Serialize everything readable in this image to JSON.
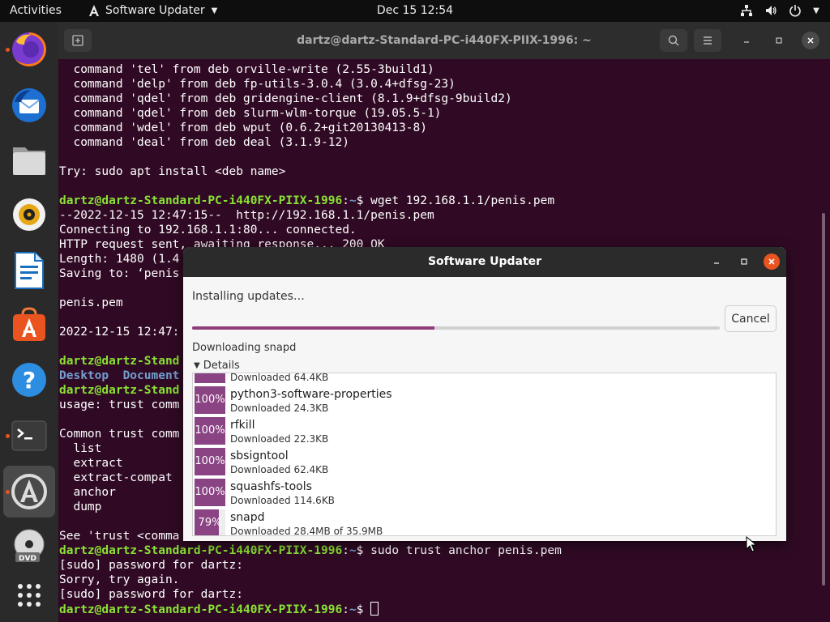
{
  "topbar": {
    "activities": "Activities",
    "app_menu": "Software Updater",
    "clock": "Dec 15  12:54"
  },
  "dock": {
    "items": [
      {
        "name": "firefox-icon",
        "running": true
      },
      {
        "name": "thunderbird-icon",
        "running": false
      },
      {
        "name": "files-icon",
        "running": false
      },
      {
        "name": "rhythmbox-icon",
        "running": false
      },
      {
        "name": "libreoffice-writer-icon",
        "running": false
      },
      {
        "name": "ubuntu-software-icon",
        "running": false
      },
      {
        "name": "help-icon",
        "running": false
      },
      {
        "name": "terminal-icon",
        "running": true
      },
      {
        "name": "software-updater-icon",
        "running": true
      },
      {
        "name": "dvd-icon",
        "running": false
      },
      {
        "name": "show-applications-icon",
        "running": false
      }
    ]
  },
  "terminal": {
    "title": "dartz@dartz-Standard-PC-i440FX-PIIX-1996: ~",
    "prompt_user": "dartz@dartz-Standard-PC-i440FX-PIIX-1996",
    "prompt_path": "~",
    "lines": {
      "l1": "  command 'tel' from deb orville-write (2.55-3build1)",
      "l2": "  command 'delp' from deb fp-utils-3.0.4 (3.0.4+dfsg-23)",
      "l3": "  command 'qdel' from deb gridengine-client (8.1.9+dfsg-9build2)",
      "l4": "  command 'qdel' from deb slurm-wlm-torque (19.05.5-1)",
      "l5": "  command 'wdel' from deb wput (0.6.2+git20130413-8)",
      "l6": "  command 'deal' from deb deal (3.1.9-12)",
      "l7": "Try: sudo apt install <deb name>",
      "l8_cmd": "$ wget 192.168.1.1/penis.pem",
      "l9": "--2022-12-15 12:47:15--  http://192.168.1.1/penis.pem",
      "l10": "Connecting to 192.168.1.1:80... connected.",
      "l11": "HTTP request sent, awaiting response... 200 OK",
      "l12": "Length: 1480 (1.4",
      "l13": "Saving to: ‘penis",
      "l14": "penis.pem",
      "l15": "2022-12-15 12:47:",
      "l16_user": "dartz@dartz-Stand",
      "l17_a": "Desktop",
      "l17_b": "Document",
      "l18_user": "dartz@dartz-Stand",
      "l19": "usage: trust comm",
      "l20": "Common trust comm",
      "l21": "  list",
      "l22": "  extract",
      "l23": "  extract-compat",
      "l24": "  anchor",
      "l25": "  dump",
      "l26": "See 'trust <comma",
      "l27_cmd": "$ sudo trust anchor penis.pem",
      "l28": "[sudo] password for dartz:",
      "l29": "Sorry, try again.",
      "l30": "[sudo] password for dartz:",
      "l31_cmd": "$ "
    }
  },
  "updater": {
    "title": "Software Updater",
    "status": "Installing updates…",
    "progress": 0.46,
    "cancel_label": "Cancel",
    "current": "Downloading snapd",
    "details_label": "Details",
    "partial_row": "Downloaded 64.4KB",
    "packages": [
      {
        "name": "python3-software-properties",
        "size": "Downloaded 24.3KB",
        "percent": "100%",
        "value": 1.0
      },
      {
        "name": "rfkill",
        "size": "Downloaded 22.3KB",
        "percent": "100%",
        "value": 1.0
      },
      {
        "name": "sbsigntool",
        "size": "Downloaded 62.4KB",
        "percent": "100%",
        "value": 1.0
      },
      {
        "name": "squashfs-tools",
        "size": "Downloaded 114.6KB",
        "percent": "100%",
        "value": 1.0
      },
      {
        "name": "snapd",
        "size": "Downloaded 28.4MB of 35.9MB",
        "percent": "79%",
        "value": 0.79
      }
    ]
  }
}
